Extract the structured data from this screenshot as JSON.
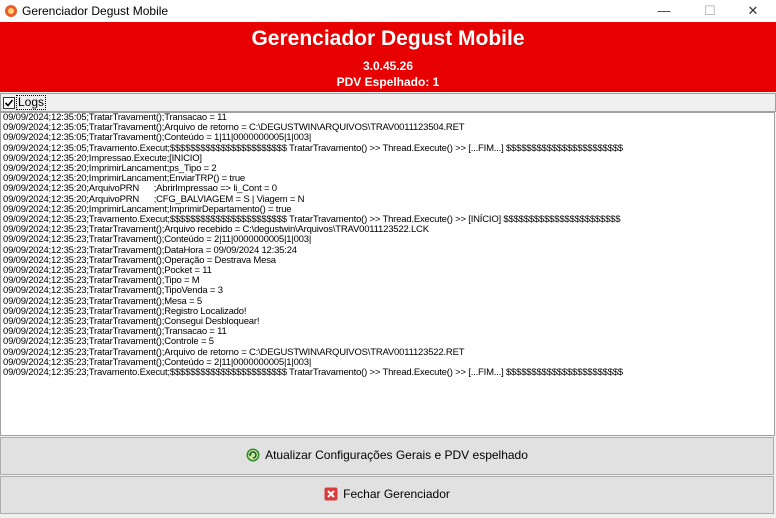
{
  "window": {
    "title": "Gerenciador Degust Mobile",
    "minimize": "—",
    "maximize": "☐",
    "close": "✕"
  },
  "banner": {
    "title": "Gerenciador Degust Mobile",
    "version": "3.0.45.26",
    "pdv": "PDV Espelhado: 1",
    "color": "#e60000"
  },
  "logs": {
    "checkbox_label": "Logs",
    "checked": true
  },
  "log_lines": [
    "09/09/2024;12:35:05;TratarTravament();Transacao = 11",
    "09/09/2024;12:35:05;TratarTravament();Arquivo de retorno = C:\\DEGUSTWIN\\ARQUIVOS\\TRAV0011123504.RET",
    "09/09/2024;12:35:05;TratarTravament();Conteúdo = 1|11|0000000005|1|003|",
    "09/09/2024;12:35:05;Travamento.Execut;$$$$$$$$$$$$$$$$$$$$$$$ TratarTravamento() >> Thread.Execute() >> [...FIM...] $$$$$$$$$$$$$$$$$$$$$$$",
    "09/09/2024;12:35:20;Impressao.Execute;[INICIO]",
    "09/09/2024;12:35:20;ImprimirLancament;ps_Tipo = 2",
    "09/09/2024;12:35:20;ImprimirLancament;EnviarTRP() = true",
    "09/09/2024;12:35:20;ArquivoPRN      ;AbrirImpressao => li_Cont = 0",
    "09/09/2024;12:35:20;ArquivoPRN      ;CFG_BALVIAGEM = S | Viagem = N",
    "09/09/2024;12:35:20;ImprimirLancament;ImprimirDepartamento() = true",
    "09/09/2024;12:35:23;Travamento.Execut;$$$$$$$$$$$$$$$$$$$$$$$ TratarTravamento() >> Thread.Execute() >> [INÍCIO] $$$$$$$$$$$$$$$$$$$$$$$",
    "09/09/2024;12:35:23;TratarTravament();Arquivo recebido = C:\\degustwin\\Arquivos\\TRAV0011123522.LCK",
    "09/09/2024;12:35:23;TratarTravament();Conteúdo = 2|11|0000000005|1|003|",
    "09/09/2024;12:35:23;TratarTravament();DataHora = 09/09/2024 12:35:24",
    "09/09/2024;12:35:23;TratarTravament();Operação = Destrava Mesa",
    "09/09/2024;12:35:23;TratarTravament();Pocket = 11",
    "09/09/2024;12:35:23;TratarTravament();Tipo = M",
    "09/09/2024;12:35:23;TratarTravament();TipoVenda = 3",
    "09/09/2024;12:35:23;TratarTravament();Mesa = 5",
    "09/09/2024;12:35:23;TratarTravament();Registro Localizado!",
    "09/09/2024;12:35:23;TratarTravament();Consegui Desbloquear!",
    "09/09/2024;12:35:23;TratarTravament();Transacao = 11",
    "09/09/2024;12:35:23;TratarTravament();Controle = 5",
    "09/09/2024;12:35:23;TratarTravament();Arquivo de retorno = C:\\DEGUSTWIN\\ARQUIVOS\\TRAV0011123522.RET",
    "09/09/2024;12:35:23;TratarTravament();Conteúdo = 2|11|0000000005|1|003|",
    "09/09/2024;12:35:23;Travamento.Execut;$$$$$$$$$$$$$$$$$$$$$$$ TratarTravamento() >> Thread.Execute() >> [...FIM...] $$$$$$$$$$$$$$$$$$$$$$$"
  ],
  "buttons": {
    "update_label": "Atualizar Configurações Gerais e PDV espelhado",
    "update_icon": "refresh-icon",
    "close_label": "Fechar Gerenciador",
    "close_icon": "close-icon"
  }
}
